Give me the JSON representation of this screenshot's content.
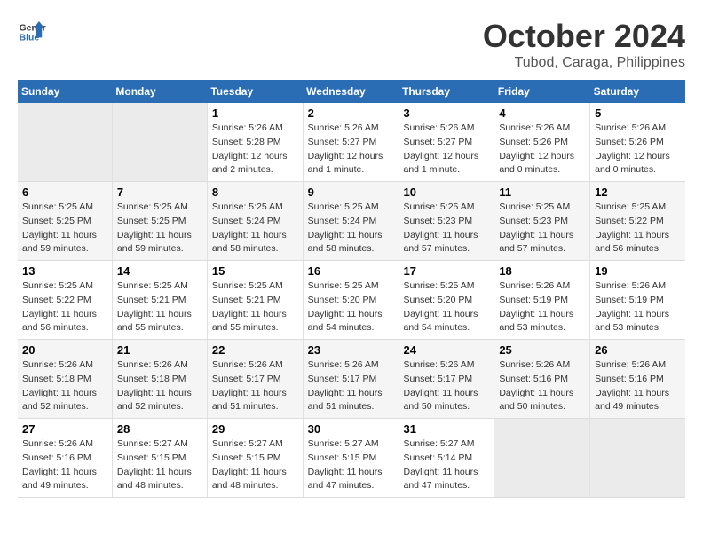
{
  "header": {
    "logo_line1": "General",
    "logo_line2": "Blue",
    "title": "October 2024",
    "subtitle": "Tubod, Caraga, Philippines"
  },
  "calendar": {
    "days_of_week": [
      "Sunday",
      "Monday",
      "Tuesday",
      "Wednesday",
      "Thursday",
      "Friday",
      "Saturday"
    ],
    "weeks": [
      [
        {
          "day": "",
          "info": ""
        },
        {
          "day": "",
          "info": ""
        },
        {
          "day": "1",
          "info": "Sunrise: 5:26 AM\nSunset: 5:28 PM\nDaylight: 12 hours\nand 2 minutes."
        },
        {
          "day": "2",
          "info": "Sunrise: 5:26 AM\nSunset: 5:27 PM\nDaylight: 12 hours\nand 1 minute."
        },
        {
          "day": "3",
          "info": "Sunrise: 5:26 AM\nSunset: 5:27 PM\nDaylight: 12 hours\nand 1 minute."
        },
        {
          "day": "4",
          "info": "Sunrise: 5:26 AM\nSunset: 5:26 PM\nDaylight: 12 hours\nand 0 minutes."
        },
        {
          "day": "5",
          "info": "Sunrise: 5:26 AM\nSunset: 5:26 PM\nDaylight: 12 hours\nand 0 minutes."
        }
      ],
      [
        {
          "day": "6",
          "info": "Sunrise: 5:25 AM\nSunset: 5:25 PM\nDaylight: 11 hours\nand 59 minutes."
        },
        {
          "day": "7",
          "info": "Sunrise: 5:25 AM\nSunset: 5:25 PM\nDaylight: 11 hours\nand 59 minutes."
        },
        {
          "day": "8",
          "info": "Sunrise: 5:25 AM\nSunset: 5:24 PM\nDaylight: 11 hours\nand 58 minutes."
        },
        {
          "day": "9",
          "info": "Sunrise: 5:25 AM\nSunset: 5:24 PM\nDaylight: 11 hours\nand 58 minutes."
        },
        {
          "day": "10",
          "info": "Sunrise: 5:25 AM\nSunset: 5:23 PM\nDaylight: 11 hours\nand 57 minutes."
        },
        {
          "day": "11",
          "info": "Sunrise: 5:25 AM\nSunset: 5:23 PM\nDaylight: 11 hours\nand 57 minutes."
        },
        {
          "day": "12",
          "info": "Sunrise: 5:25 AM\nSunset: 5:22 PM\nDaylight: 11 hours\nand 56 minutes."
        }
      ],
      [
        {
          "day": "13",
          "info": "Sunrise: 5:25 AM\nSunset: 5:22 PM\nDaylight: 11 hours\nand 56 minutes."
        },
        {
          "day": "14",
          "info": "Sunrise: 5:25 AM\nSunset: 5:21 PM\nDaylight: 11 hours\nand 55 minutes."
        },
        {
          "day": "15",
          "info": "Sunrise: 5:25 AM\nSunset: 5:21 PM\nDaylight: 11 hours\nand 55 minutes."
        },
        {
          "day": "16",
          "info": "Sunrise: 5:25 AM\nSunset: 5:20 PM\nDaylight: 11 hours\nand 54 minutes."
        },
        {
          "day": "17",
          "info": "Sunrise: 5:25 AM\nSunset: 5:20 PM\nDaylight: 11 hours\nand 54 minutes."
        },
        {
          "day": "18",
          "info": "Sunrise: 5:26 AM\nSunset: 5:19 PM\nDaylight: 11 hours\nand 53 minutes."
        },
        {
          "day": "19",
          "info": "Sunrise: 5:26 AM\nSunset: 5:19 PM\nDaylight: 11 hours\nand 53 minutes."
        }
      ],
      [
        {
          "day": "20",
          "info": "Sunrise: 5:26 AM\nSunset: 5:18 PM\nDaylight: 11 hours\nand 52 minutes."
        },
        {
          "day": "21",
          "info": "Sunrise: 5:26 AM\nSunset: 5:18 PM\nDaylight: 11 hours\nand 52 minutes."
        },
        {
          "day": "22",
          "info": "Sunrise: 5:26 AM\nSunset: 5:17 PM\nDaylight: 11 hours\nand 51 minutes."
        },
        {
          "day": "23",
          "info": "Sunrise: 5:26 AM\nSunset: 5:17 PM\nDaylight: 11 hours\nand 51 minutes."
        },
        {
          "day": "24",
          "info": "Sunrise: 5:26 AM\nSunset: 5:17 PM\nDaylight: 11 hours\nand 50 minutes."
        },
        {
          "day": "25",
          "info": "Sunrise: 5:26 AM\nSunset: 5:16 PM\nDaylight: 11 hours\nand 50 minutes."
        },
        {
          "day": "26",
          "info": "Sunrise: 5:26 AM\nSunset: 5:16 PM\nDaylight: 11 hours\nand 49 minutes."
        }
      ],
      [
        {
          "day": "27",
          "info": "Sunrise: 5:26 AM\nSunset: 5:16 PM\nDaylight: 11 hours\nand 49 minutes."
        },
        {
          "day": "28",
          "info": "Sunrise: 5:27 AM\nSunset: 5:15 PM\nDaylight: 11 hours\nand 48 minutes."
        },
        {
          "day": "29",
          "info": "Sunrise: 5:27 AM\nSunset: 5:15 PM\nDaylight: 11 hours\nand 48 minutes."
        },
        {
          "day": "30",
          "info": "Sunrise: 5:27 AM\nSunset: 5:15 PM\nDaylight: 11 hours\nand 47 minutes."
        },
        {
          "day": "31",
          "info": "Sunrise: 5:27 AM\nSunset: 5:14 PM\nDaylight: 11 hours\nand 47 minutes."
        },
        {
          "day": "",
          "info": ""
        },
        {
          "day": "",
          "info": ""
        }
      ]
    ]
  }
}
